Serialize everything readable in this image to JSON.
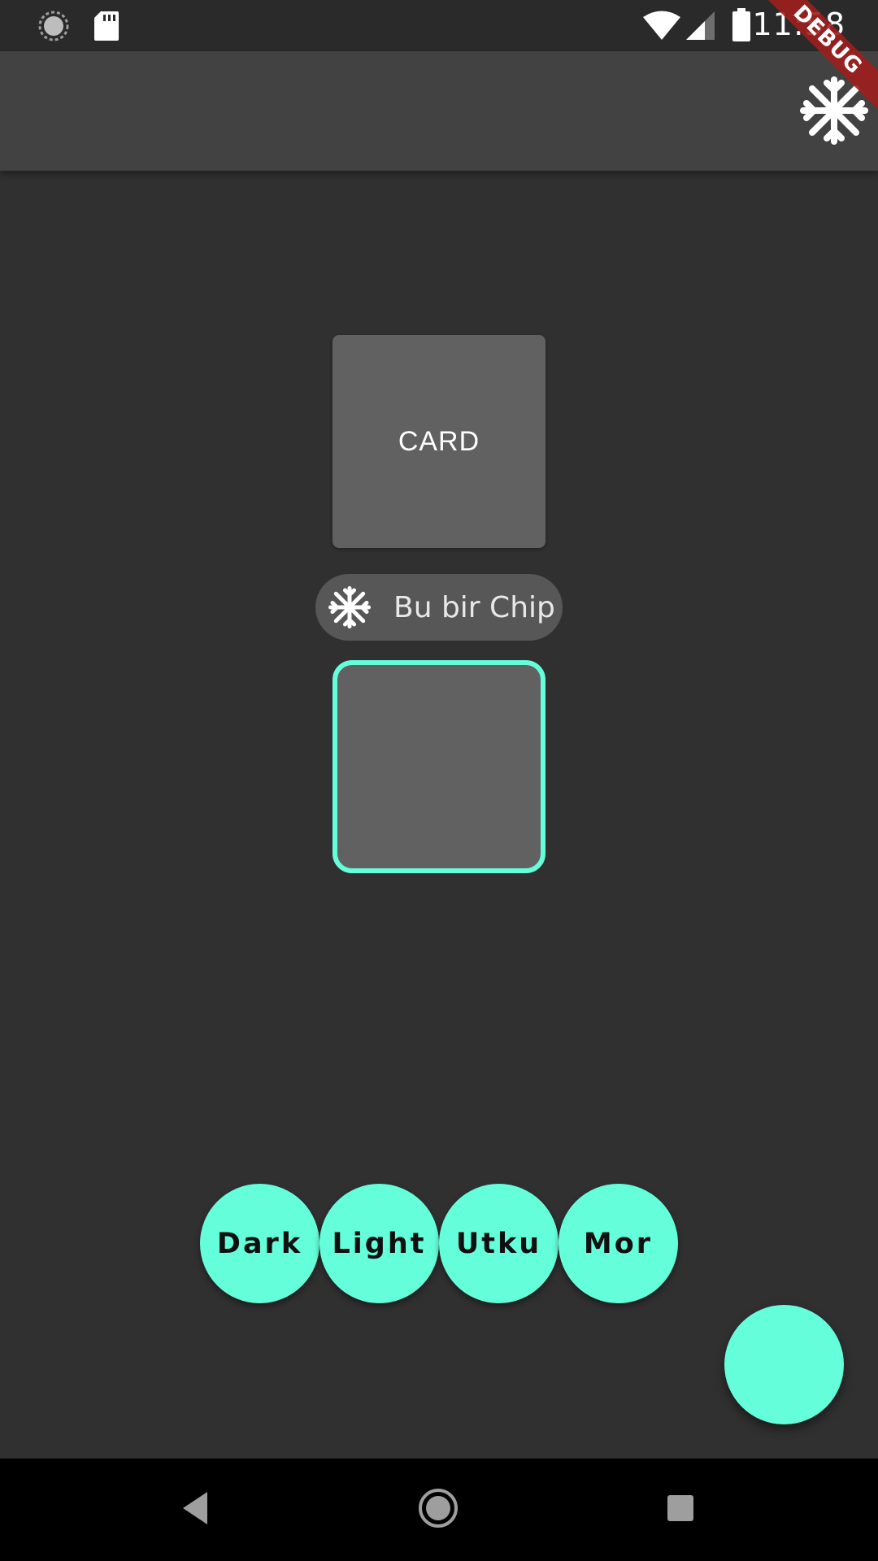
{
  "status_bar": {
    "time": "11:58",
    "icons": [
      "sync-icon",
      "sd-card-icon",
      "wifi-icon",
      "signal-icon",
      "battery-icon"
    ]
  },
  "app_bar": {
    "action_icon": "snowflake-icon",
    "debug_banner": "DEBUG"
  },
  "card": {
    "label": "CARD"
  },
  "chip": {
    "icon": "snowflake-icon",
    "label": "Bu bir Chip"
  },
  "theme_buttons": [
    {
      "label": "Dark"
    },
    {
      "label": "Light"
    },
    {
      "label": "Utku"
    },
    {
      "label": "Mor"
    }
  ],
  "colors": {
    "accent": "#64ffda",
    "background": "#303030",
    "app_bar": "#424242",
    "card": "#616161"
  },
  "nav_bar": {
    "icons": [
      "back-icon",
      "home-icon",
      "recents-icon"
    ]
  }
}
